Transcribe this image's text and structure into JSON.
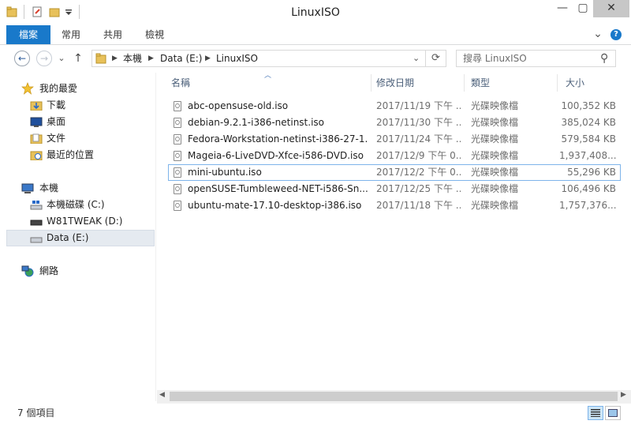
{
  "window": {
    "title": "LinuxISO",
    "minimize": "—",
    "maximize": "▢",
    "close": "✕"
  },
  "ribbon": {
    "tabs": [
      {
        "label": "檔案"
      },
      {
        "label": "常用"
      },
      {
        "label": "共用"
      },
      {
        "label": "檢視"
      }
    ],
    "expand_icon": "⌄",
    "help_icon": "?"
  },
  "address": {
    "back": "←",
    "forward": "→",
    "dropdown": "⌄",
    "up": "↑",
    "crumbs": [
      "本機",
      "Data (E:)",
      "LinuxISO"
    ],
    "sep": "▶",
    "refresh": "⟳",
    "search_placeholder": "搜尋 LinuxISO",
    "search_icon": "⚲"
  },
  "nav": {
    "favorites": "我的最愛",
    "favorites_items": [
      "下載",
      "桌面",
      "文件",
      "最近的位置"
    ],
    "this_pc": "本機",
    "drives": [
      "本機磁碟 (C:)",
      "W81TWEAK (D:)",
      "Data (E:)"
    ],
    "network": "網路"
  },
  "list": {
    "sort_indicator": "︿",
    "columns": {
      "name": "名稱",
      "date": "修改日期",
      "type": "類型",
      "size": "大小"
    },
    "rows": [
      {
        "name": "abc-opensuse-old.iso",
        "date": "2017/11/19 下午 ...",
        "type": "光碟映像檔",
        "size": "100,352 KB"
      },
      {
        "name": "debian-9.2.1-i386-netinst.iso",
        "date": "2017/11/30 下午 ...",
        "type": "光碟映像檔",
        "size": "385,024 KB"
      },
      {
        "name": "Fedora-Workstation-netinst-i386-27-1...",
        "date": "2017/11/24 下午 ...",
        "type": "光碟映像檔",
        "size": "579,584 KB"
      },
      {
        "name": "Mageia-6-LiveDVD-Xfce-i586-DVD.iso",
        "date": "2017/12/9 下午 0...",
        "type": "光碟映像檔",
        "size": "1,937,408..."
      },
      {
        "name": "mini-ubuntu.iso",
        "date": "2017/12/2 下午 0...",
        "type": "光碟映像檔",
        "size": "55,296 KB"
      },
      {
        "name": "openSUSE-Tumbleweed-NET-i586-Sn...",
        "date": "2017/12/25 下午 ...",
        "type": "光碟映像檔",
        "size": "106,496 KB"
      },
      {
        "name": "ubuntu-mate-17.10-desktop-i386.iso",
        "date": "2017/11/18 下午 ...",
        "type": "光碟映像檔",
        "size": "1,757,376..."
      }
    ]
  },
  "scroll": {
    "left": "◀",
    "right": "▶"
  },
  "status": {
    "item_count": "7 個項目"
  }
}
